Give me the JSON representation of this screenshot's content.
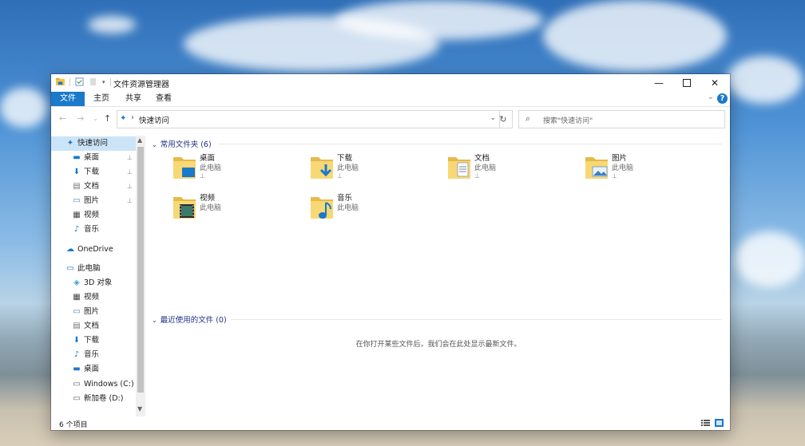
{
  "window": {
    "title": "文件资源管理器",
    "controls": [
      "minimize",
      "maximize",
      "close"
    ]
  },
  "ribbon": {
    "tabs": [
      "文件",
      "主页",
      "共享",
      "查看"
    ],
    "active_tab": "文件",
    "help_label": "?"
  },
  "navbar": {
    "address_path": "快速访问",
    "search_placeholder": "搜索\"快速访问\""
  },
  "sidebar": {
    "items": [
      {
        "label": "快速访问",
        "icon": "star-pin-icon",
        "selected": true,
        "pinned": false
      },
      {
        "label": "桌面",
        "icon": "desktop-icon",
        "pinned": true
      },
      {
        "label": "下载",
        "icon": "download-icon",
        "pinned": true
      },
      {
        "label": "文档",
        "icon": "document-icon",
        "pinned": true
      },
      {
        "label": "图片",
        "icon": "picture-icon",
        "pinned": true
      },
      {
        "label": "视频",
        "icon": "video-icon",
        "pinned": false
      },
      {
        "label": "音乐",
        "icon": "music-icon",
        "pinned": false
      },
      {
        "label": "OneDrive",
        "icon": "cloud-icon",
        "pinned": false
      },
      {
        "label": "此电脑",
        "icon": "computer-icon",
        "pinned": false
      },
      {
        "label": "3D 对象",
        "icon": "cube-icon",
        "pinned": false
      },
      {
        "label": "视频",
        "icon": "video-icon",
        "pinned": false
      },
      {
        "label": "图片",
        "icon": "picture-icon",
        "pinned": false
      },
      {
        "label": "文档",
        "icon": "document-icon",
        "pinned": false
      },
      {
        "label": "下载",
        "icon": "download-icon",
        "pinned": false
      },
      {
        "label": "音乐",
        "icon": "music-icon",
        "pinned": false
      },
      {
        "label": "桌面",
        "icon": "desktop-icon",
        "pinned": false
      },
      {
        "label": "Windows (C:)",
        "icon": "drive-icon",
        "pinned": false
      },
      {
        "label": "新加卷 (D:)",
        "icon": "drive-icon",
        "pinned": false
      }
    ]
  },
  "content": {
    "frequent_header": "常用文件夹 (6)",
    "recent_header": "最近使用的文件 (0)",
    "folders": [
      {
        "name": "桌面",
        "sub": "此电脑",
        "pinned": true,
        "icon": "desktop-folder-icon"
      },
      {
        "name": "下载",
        "sub": "此电脑",
        "pinned": true,
        "icon": "download-folder-icon"
      },
      {
        "name": "文档",
        "sub": "此电脑",
        "pinned": true,
        "icon": "document-folder-icon"
      },
      {
        "name": "图片",
        "sub": "此电脑",
        "pinned": true,
        "icon": "picture-folder-icon"
      },
      {
        "name": "视频",
        "sub": "此电脑",
        "pinned": false,
        "icon": "video-folder-icon"
      },
      {
        "name": "音乐",
        "sub": "此电脑",
        "pinned": false,
        "icon": "music-folder-icon"
      }
    ],
    "recent_empty_message": "在你打开某些文件后，我们会在此处显示最新文件。"
  },
  "status": {
    "item_count": "6 个项目"
  },
  "colors": {
    "accent": "#1979ca",
    "selection": "#cce4f7",
    "folder": "#f8d775",
    "group_header": "#1e3287"
  }
}
